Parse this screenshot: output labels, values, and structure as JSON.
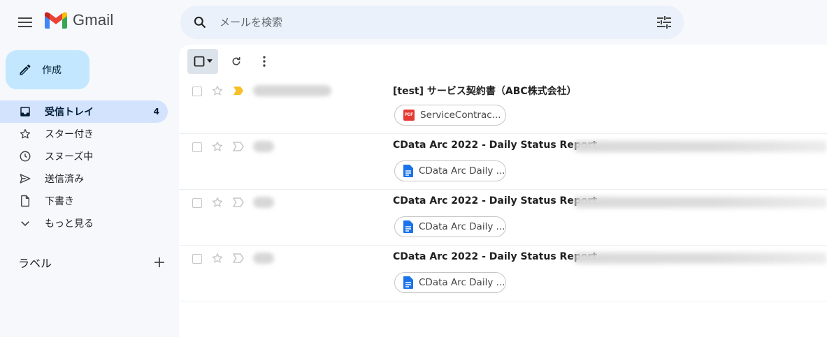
{
  "app": {
    "name": "Gmail"
  },
  "search": {
    "placeholder": "メールを検索"
  },
  "compose": {
    "label": "作成"
  },
  "sidebar": {
    "items": [
      {
        "label": "受信トレイ",
        "count": "4",
        "icon": "inbox-icon",
        "active": true
      },
      {
        "label": "スター付き",
        "count": "",
        "icon": "star-icon",
        "active": false
      },
      {
        "label": "スヌーズ中",
        "count": "",
        "icon": "clock-icon",
        "active": false
      },
      {
        "label": "送信済み",
        "count": "",
        "icon": "send-icon",
        "active": false
      },
      {
        "label": "下書き",
        "count": "",
        "icon": "draft-icon",
        "active": false
      },
      {
        "label": "もっと見る",
        "count": "",
        "icon": "chevron-down-icon",
        "active": false
      }
    ],
    "labels_title": "ラベル"
  },
  "toolbar": {
    "icons": [
      "select-all-checkbox",
      "refresh-icon",
      "more-vert-icon"
    ]
  },
  "emails": [
    {
      "subject": "[test] サービス契約書（ABC株式会社）",
      "attachment": "ServiceContrac...",
      "attachment_type": "pdf",
      "important": true
    },
    {
      "subject": "CData Arc 2022 - Daily Status Report",
      "attachment": "CData Arc Daily ...",
      "attachment_type": "doc",
      "important": false
    },
    {
      "subject": "CData Arc 2022 - Daily Status Report",
      "attachment": "CData Arc Daily ...",
      "attachment_type": "doc",
      "important": false
    },
    {
      "subject": "CData Arc 2022 - Daily Status Report",
      "attachment": "CData Arc Daily ...",
      "attachment_type": "doc",
      "important": false
    }
  ],
  "colors": {
    "compose_bg": "#c2e7ff",
    "active_nav_bg": "#d3e3fd",
    "search_bg": "#eaf1fb",
    "important_marker": "#f6c026",
    "pdf_red": "#e53935",
    "doc_blue": "#1a73e8"
  }
}
